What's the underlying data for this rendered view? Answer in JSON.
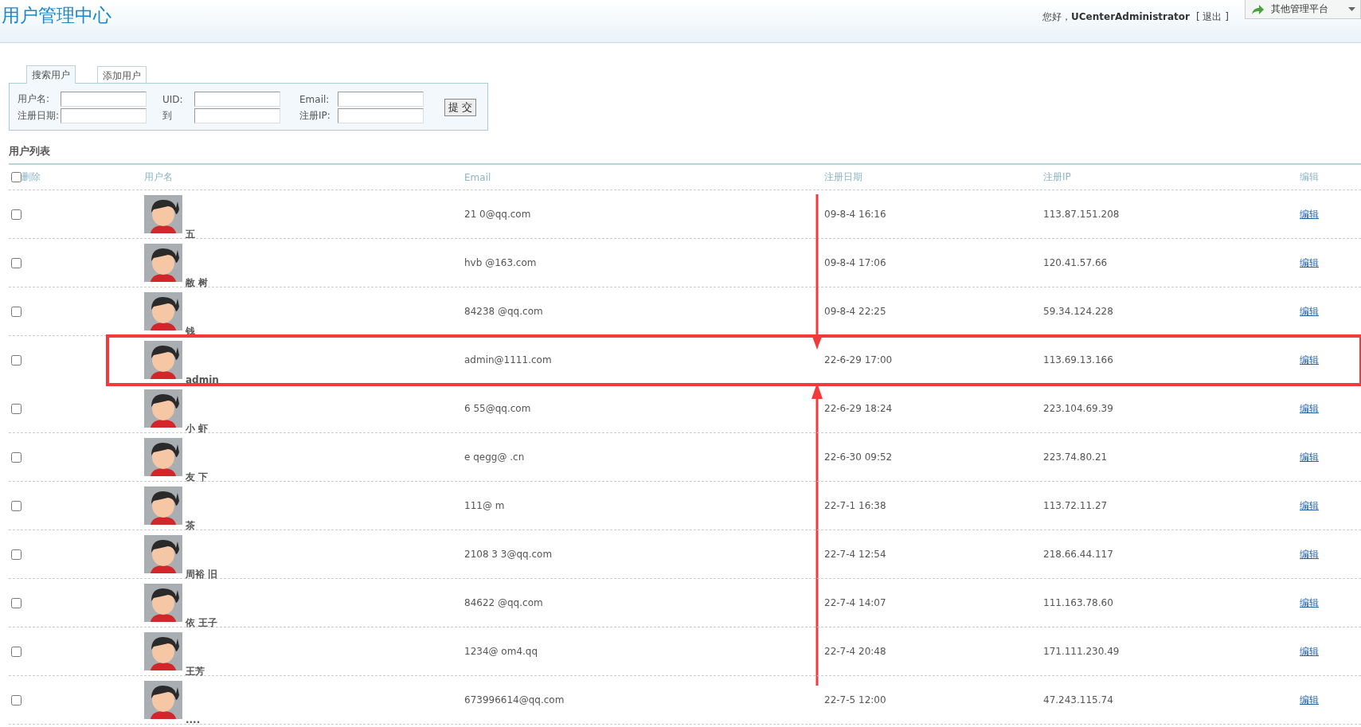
{
  "header": {
    "title": "用户管理中心",
    "greeting": "您好，**UCenterAdministrator**",
    "logout_link": "[ 退出 ]",
    "platform_menu": "其他管理平台"
  },
  "search": {
    "tabs": [
      {
        "label": "搜索用户",
        "selected": true
      },
      {
        "label": "添加用户",
        "selected": false
      }
    ],
    "fields": [
      {
        "label": "用户名:"
      },
      {
        "label": "UID:"
      },
      {
        "label": "Email:"
      },
      {
        "label": "注册日期:"
      },
      {
        "label": "到"
      },
      {
        "label": "注册IP:"
      }
    ],
    "submit": "提 交"
  },
  "list_title": "用户列表",
  "table": {
    "select_all": {
      "label": "删除",
      "checked": false
    },
    "columns": [
      "用户名",
      "Email",
      "注册日期",
      "注册IP",
      "编辑"
    ],
    "rows": [
      {
        "checked": false,
        "highlighted": false,
        "name": "五",
        "email": "21 0@qq.com",
        "date": "09-8-4 16:16",
        "ip": "113.87.151.208",
        "action": "编辑"
      },
      {
        "checked": false,
        "highlighted": false,
        "name": "敝 树",
        "email": "hvb @163.com",
        "date": "09-8-4 17:06",
        "ip": "120.41.57.66",
        "action": "编辑"
      },
      {
        "checked": false,
        "highlighted": false,
        "name": "钱",
        "email": "84238 @qq.com",
        "date": "09-8-4 22:25",
        "ip": "59.34.124.228",
        "action": "编辑"
      },
      {
        "checked": false,
        "highlighted": true,
        "name": "admin",
        "email": "admin@1111.com",
        "date": "22-6-29 17:00",
        "ip": "113.69.13.166",
        "action": "编辑"
      },
      {
        "checked": false,
        "highlighted": false,
        "name": "小 虾",
        "email": "6 55@qq.com",
        "date": "22-6-29 18:24",
        "ip": "223.104.69.39",
        "action": "编辑"
      },
      {
        "checked": false,
        "highlighted": false,
        "name": "友 下",
        "email": "e qegg@ .cn",
        "date": "22-6-30 09:52",
        "ip": "223.74.80.21",
        "action": "编辑"
      },
      {
        "checked": false,
        "highlighted": false,
        "name": "茶",
        "email": "111@ m",
        "date": "22-7-1 16:38",
        "ip": "113.72.11.27",
        "action": "编辑"
      },
      {
        "checked": false,
        "highlighted": false,
        "name": "周裕 旧",
        "email": "2108 3 3@qq.com",
        "date": "22-7-4 12:54",
        "ip": "218.66.44.117",
        "action": "编辑"
      },
      {
        "checked": false,
        "highlighted": false,
        "name": "依 王子",
        "email": "84622 @qq.com",
        "date": "22-7-4 14:07",
        "ip": "111.163.78.60",
        "action": "编辑"
      },
      {
        "checked": false,
        "highlighted": false,
        "name": "王芳",
        "email": "1234@ om4.qq",
        "date": "22-7-4 20:48",
        "ip": "171.111.230.49",
        "action": "编辑"
      },
      {
        "checked": false,
        "highlighted": false,
        "name": "....",
        "email": "673996614@qq.com",
        "date": "22-7-5 12:00",
        "ip": "47.243.115.74",
        "action": "编辑"
      }
    ]
  }
}
